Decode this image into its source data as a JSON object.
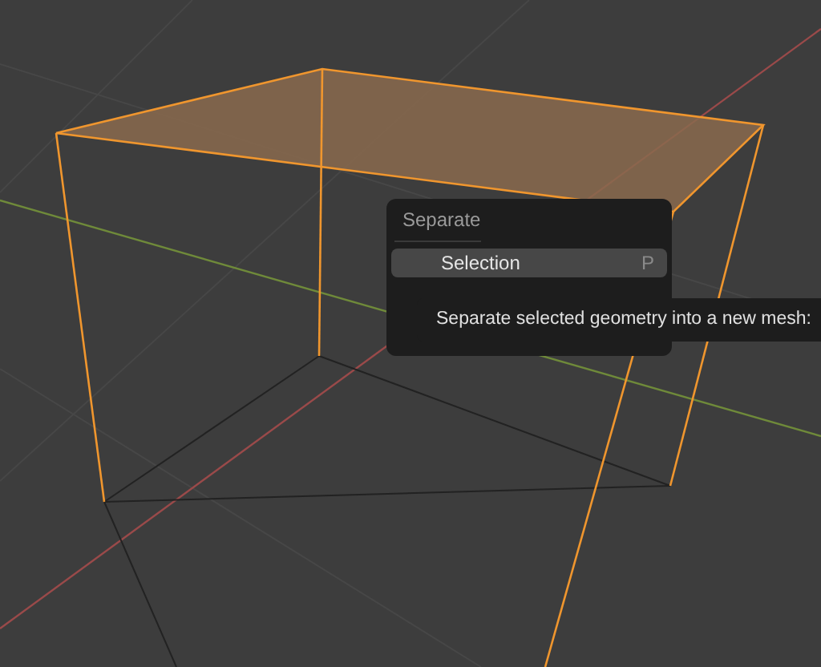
{
  "menu": {
    "title": "Separate",
    "items": [
      {
        "label": "Selection",
        "shortcut": "P",
        "selected": true
      }
    ]
  },
  "tooltip": {
    "text": "Separate selected geometry into a new mesh:"
  }
}
